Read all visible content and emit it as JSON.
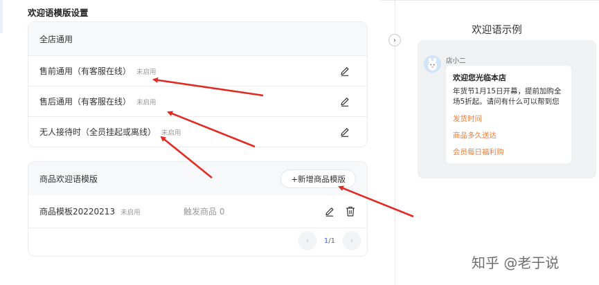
{
  "page": {
    "title": "欢迎语模版设置"
  },
  "store_card": {
    "header": "全店通用",
    "rows": [
      {
        "label": "售前通用（有客服在线）",
        "status": "未启用"
      },
      {
        "label": "售后通用（有客服在线）",
        "status": "未启用"
      },
      {
        "label": "无人接待时（全员挂起或离线）",
        "status": "未启用"
      }
    ]
  },
  "product_card": {
    "header": "商品欢迎语模版",
    "add_button": "+新增商品模版",
    "rows": [
      {
        "name": "商品模板20220213",
        "status": "未启用",
        "trigger": "触发商品 0"
      }
    ],
    "pager": {
      "prev": "‹",
      "current": "1",
      "total": "/1",
      "next": "›"
    }
  },
  "collapse_toggle": "›",
  "example": {
    "title": "欢迎语示例",
    "name": "店小二",
    "bubble_title": "欢迎您光临本店",
    "bubble_text": "年货节1月15日开幕，提前加购全场5折起。请问有什么可以帮到您",
    "links": [
      "发货时间",
      "商品多久送达",
      "会员每日福利购"
    ],
    "link_color": "#f07d33"
  },
  "watermark": "知乎 @老于说",
  "icons": {
    "edit": "pencil-icon",
    "delete": "trash-icon"
  },
  "annotation_color": "#e02a22"
}
